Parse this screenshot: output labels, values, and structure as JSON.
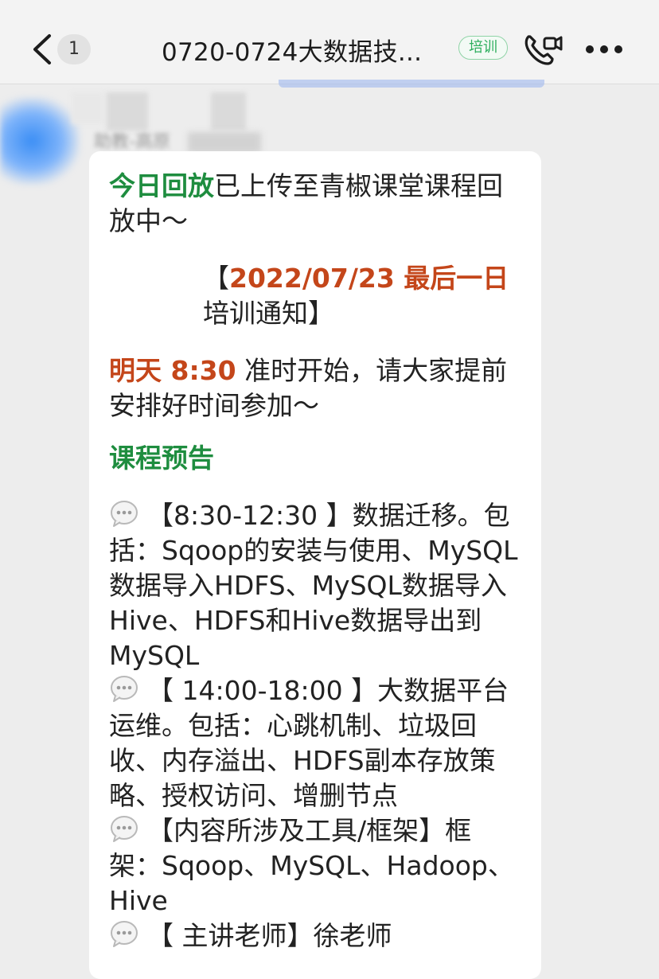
{
  "header": {
    "badge_count": "1",
    "title": "0720-0724大数据技...",
    "tag": "培训"
  },
  "sender": {
    "name": "助教-高原"
  },
  "message": {
    "line1_green": "今日回放",
    "line1_rest": "已上传至青椒课堂课程回放中～",
    "notice_open": "【",
    "notice_date": "2022/07/23 最后一日",
    "notice_rest": "培训通知】",
    "time_highlight": "明天 8:30",
    "time_rest": " 准时开始，请大家提前安排好时间参加～",
    "preview_title": "课程预告",
    "items": [
      "【8:30-12:30 】数据迁移。包括：Sqoop的安装与使用、MySQL数据导入HDFS、MySQL数据导入Hive、HDFS和Hive数据导出到MySQL",
      "【 14:00-18:00 】大数据平台运维。包括：心跳机制、垃圾回收、内存溢出、HDFS副本存放策略、授权访问、增删节点",
      "【内容所涉及工具/框架】框架：Sqoop、MySQL、Hadoop、Hive",
      "【 主讲老师】徐老师"
    ]
  },
  "colors": {
    "green": "#1e8d3f",
    "orange": "#c4461a",
    "tag_green": "#2eaf5e"
  }
}
